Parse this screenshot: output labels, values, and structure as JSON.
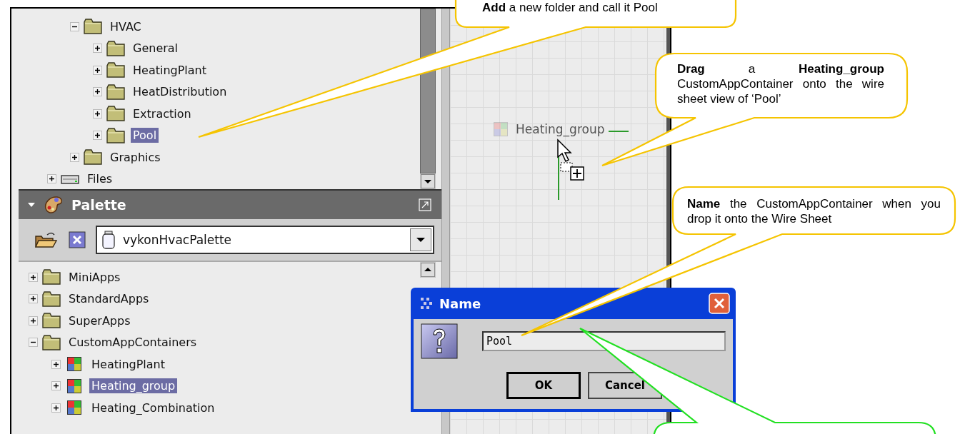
{
  "nav_tree": {
    "items": [
      {
        "children": [
          {
            "label": "HVAC",
            "kind": "folder",
            "expanded": true,
            "selected": false,
            "children": [
              {
                "label": "General",
                "kind": "folder",
                "expanded": false,
                "selected": false
              },
              {
                "label": "HeatingPlant",
                "kind": "folder",
                "expanded": false,
                "selected": false
              },
              {
                "label": "HeatDistribution",
                "kind": "folder",
                "expanded": false,
                "selected": false
              },
              {
                "label": "Extraction",
                "kind": "folder",
                "expanded": false,
                "selected": false
              },
              {
                "label": "Pool",
                "kind": "folder",
                "expanded": false,
                "selected": true
              }
            ]
          },
          {
            "label": "Graphics",
            "kind": "folder",
            "expanded": false,
            "selected": false
          }
        ]
      },
      {
        "label": "Files",
        "kind": "files",
        "expanded": false,
        "selected": false
      }
    ]
  },
  "palette": {
    "title": "Palette",
    "palette_name": "vykonHvacPalette",
    "items": [
      {
        "label": "MiniApps",
        "kind": "folder",
        "expanded": false,
        "selected": false
      },
      {
        "label": "StandardApps",
        "kind": "folder",
        "expanded": false,
        "selected": false
      },
      {
        "label": "SuperApps",
        "kind": "folder",
        "expanded": false,
        "selected": false
      },
      {
        "label": "CustomAppContainers",
        "kind": "folder",
        "expanded": true,
        "selected": false,
        "children": [
          {
            "label": "HeatingPlant",
            "kind": "app",
            "expanded": false,
            "selected": false
          },
          {
            "label": "Heating_group",
            "kind": "app",
            "expanded": false,
            "selected": true
          },
          {
            "label": "Heating_Combination",
            "kind": "app",
            "expanded": false,
            "selected": false
          }
        ]
      }
    ]
  },
  "wire_sheet": {
    "dragged_item": {
      "label": "Heating_group"
    }
  },
  "dialog": {
    "title": "Name",
    "value": "Pool",
    "buttons": [
      "OK",
      "Cancel"
    ]
  },
  "callouts": [
    {
      "text": "**Add** a new folder and call it Pool",
      "color": "#f5c400"
    },
    {
      "text": "**Drag** a **Heating_group** CustomAppContainer onto the wire sheet view of ‘Pool’",
      "color": "#f5c400"
    },
    {
      "text": "**Name** the CustomAppContainer when you drop it onto the Wire Sheet",
      "color": "#f5c400"
    },
    {
      "color": "#22e022"
    }
  ]
}
